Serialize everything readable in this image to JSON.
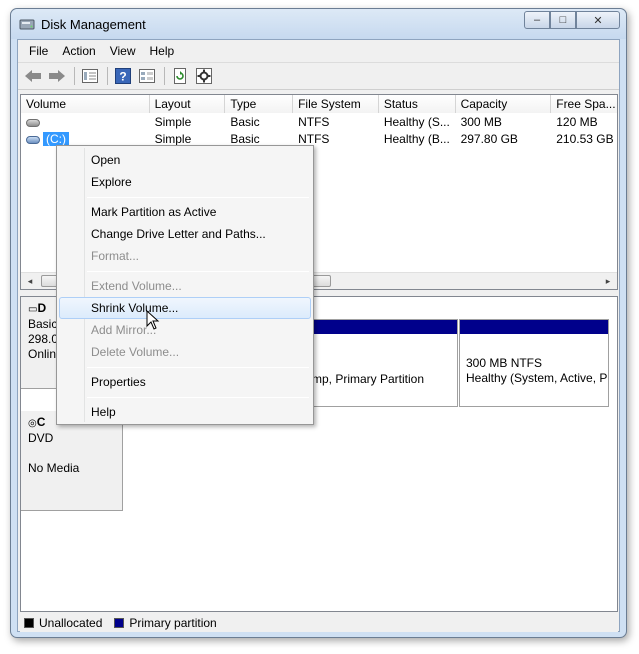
{
  "window": {
    "title": "Disk Management",
    "buttons": {
      "minimize": "–",
      "maximize": "□",
      "close": "✕"
    }
  },
  "menu": [
    "File",
    "Action",
    "View",
    "Help"
  ],
  "toolbar": {
    "icons": [
      "back-arrow-icon",
      "forward-arrow-icon",
      "list-icon",
      "help-icon",
      "properties-icon",
      "refresh-icon",
      "settings-icon"
    ]
  },
  "volume_list": {
    "columns": [
      "Volume",
      "Layout",
      "Type",
      "File System",
      "Status",
      "Capacity",
      "Free Spa..."
    ],
    "rows": [
      {
        "volume": "",
        "layout": "Simple",
        "type": "Basic",
        "fs": "NTFS",
        "status": "Healthy (S...",
        "capacity": "300 MB",
        "free": "120 MB"
      },
      {
        "volume": "(C:)",
        "layout": "Simple",
        "type": "Basic",
        "fs": "NTFS",
        "status": "Healthy (B...",
        "capacity": "297.80 GB",
        "free": "210.53 GB"
      }
    ]
  },
  "disks": {
    "disk0": {
      "name": "D",
      "lines": [
        "Basic",
        "298.0",
        "Onlin"
      ]
    },
    "cdrom": {
      "name": "C",
      "lines": [
        "DVD",
        "",
        "No Media"
      ]
    }
  },
  "partitions": {
    "c_partition": {
      "line2": "mp, Primary Partition"
    },
    "system_partition": {
      "line1": "300 MB NTFS",
      "line2": "Healthy (System, Active, P"
    }
  },
  "legend": {
    "unallocated": "Unallocated",
    "primary": "Primary partition",
    "unallocated_color": "#000000",
    "primary_color": "#00008b"
  },
  "context_menu": {
    "open": "Open",
    "explore": "Explore",
    "mark_active": "Mark Partition as Active",
    "change_letter": "Change Drive Letter and Paths...",
    "format": "Format...",
    "extend": "Extend Volume...",
    "shrink": "Shrink Volume...",
    "add_mirror": "Add Mirror...",
    "delete": "Delete Volume...",
    "properties": "Properties",
    "help": "Help"
  }
}
